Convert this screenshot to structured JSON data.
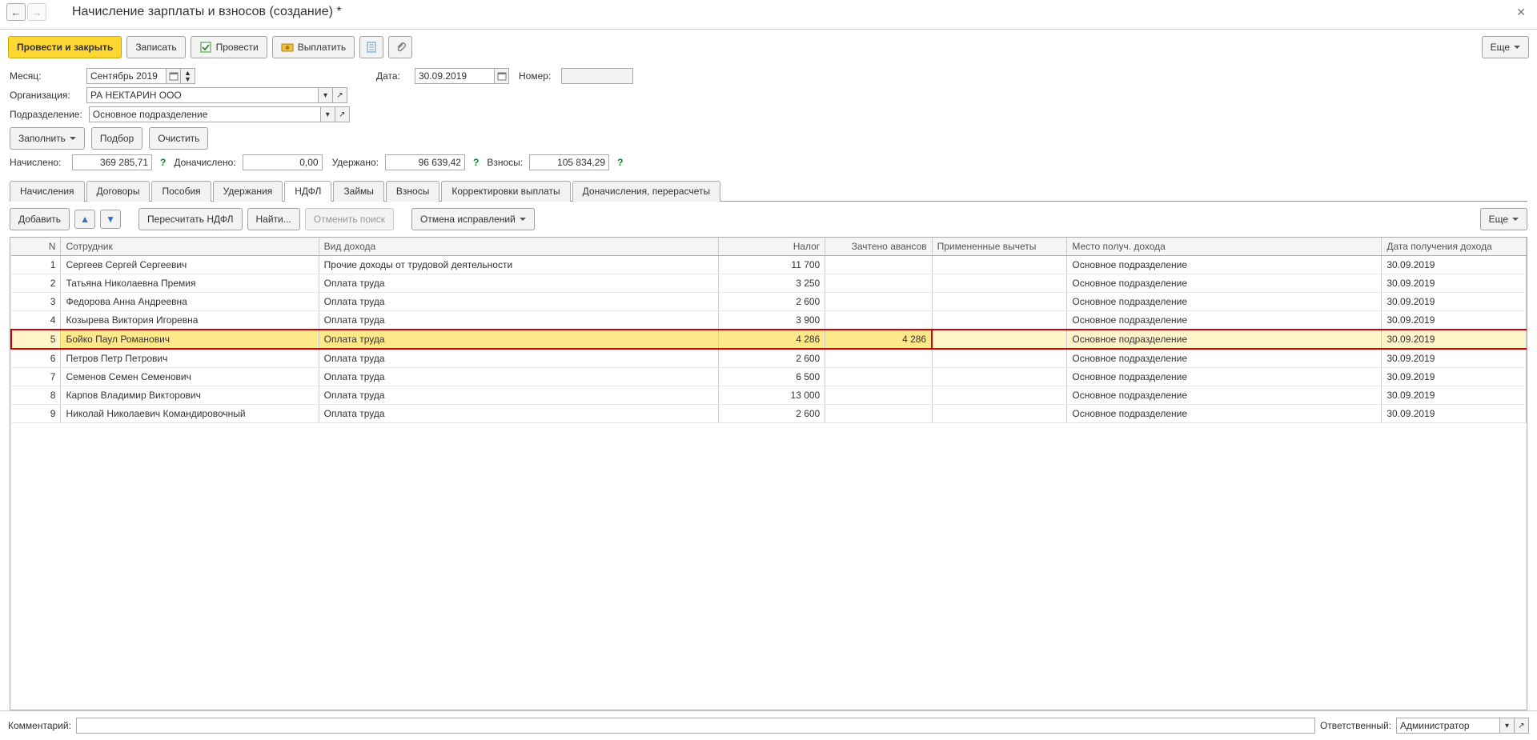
{
  "title": "Начисление зарплаты и взносов (создание) *",
  "toolbar": {
    "post_close": "Провести и закрыть",
    "save": "Записать",
    "post": "Провести",
    "pay": "Выплатить",
    "more": "Еще"
  },
  "form": {
    "month_lbl": "Месяц:",
    "month_val": "Сентябрь 2019",
    "date_lbl": "Дата:",
    "date_val": "30.09.2019",
    "number_lbl": "Номер:",
    "number_val": "",
    "org_lbl": "Организация:",
    "org_val": "РА НЕКТАРИН ООО",
    "dept_lbl": "Подразделение:",
    "dept_val": "Основное подразделение",
    "fill": "Заполнить",
    "pick": "Подбор",
    "clear": "Очистить",
    "accrued_lbl": "Начислено:",
    "accrued_val": "369 285,71",
    "extra_lbl": "Доначислено:",
    "extra_val": "0,00",
    "withheld_lbl": "Удержано:",
    "withheld_val": "96 639,42",
    "contrib_lbl": "Взносы:",
    "contrib_val": "105 834,29"
  },
  "tabs": [
    "Начисления",
    "Договоры",
    "Пособия",
    "Удержания",
    "НДФЛ",
    "Займы",
    "Взносы",
    "Корректировки выплаты",
    "Доначисления, перерасчеты"
  ],
  "active_tab": 4,
  "sub": {
    "add": "Добавить",
    "recalc": "Пересчитать НДФЛ",
    "find": "Найти...",
    "cancel_search": "Отменить поиск",
    "cancel_fix": "Отмена исправлений",
    "more": "Еще"
  },
  "cols": [
    "N",
    "Сотрудник",
    "Вид дохода",
    "Налог",
    "Зачтено авансов",
    "Примененные вычеты",
    "Место получ. дохода",
    "Дата получения дохода"
  ],
  "rows": [
    {
      "n": "1",
      "emp": "Сергеев Сергей Сергеевич",
      "type": "Прочие доходы от трудовой деятельности",
      "tax": "11 700",
      "adv": "",
      "ded": "",
      "loc": "Основное подразделение",
      "date": "30.09.2019"
    },
    {
      "n": "2",
      "emp": "Татьяна Николаевна Премия",
      "type": "Оплата труда",
      "tax": "3 250",
      "adv": "",
      "ded": "",
      "loc": "Основное подразделение",
      "date": "30.09.2019"
    },
    {
      "n": "3",
      "emp": "Федорова Анна Андреевна",
      "type": "Оплата труда",
      "tax": "2 600",
      "adv": "",
      "ded": "",
      "loc": "Основное подразделение",
      "date": "30.09.2019"
    },
    {
      "n": "4",
      "emp": "Козырева Виктория Игоревна",
      "type": "Оплата труда",
      "tax": "3 900",
      "adv": "",
      "ded": "",
      "loc": "Основное подразделение",
      "date": "30.09.2019"
    },
    {
      "n": "5",
      "emp": "Бойко Паул Романович",
      "type": "Оплата труда",
      "tax": "4 286",
      "adv": "4 286",
      "ded": "",
      "loc": "Основное подразделение",
      "date": "30.09.2019",
      "hl": true
    },
    {
      "n": "6",
      "emp": "Петров Петр Петрович",
      "type": "Оплата труда",
      "tax": "2 600",
      "adv": "",
      "ded": "",
      "loc": "Основное подразделение",
      "date": "30.09.2019"
    },
    {
      "n": "7",
      "emp": "Семенов Семен Семенович",
      "type": "Оплата труда",
      "tax": "6 500",
      "adv": "",
      "ded": "",
      "loc": "Основное подразделение",
      "date": "30.09.2019"
    },
    {
      "n": "8",
      "emp": "Карпов Владимир Викторович",
      "type": "Оплата труда",
      "tax": "13 000",
      "adv": "",
      "ded": "",
      "loc": "Основное подразделение",
      "date": "30.09.2019"
    },
    {
      "n": "9",
      "emp": "Николай Николаевич Командировочный",
      "type": "Оплата труда",
      "tax": "2 600",
      "adv": "",
      "ded": "",
      "loc": "Основное подразделение",
      "date": "30.09.2019"
    }
  ],
  "footer": {
    "comment_lbl": "Комментарий:",
    "comment_val": "",
    "resp_lbl": "Ответственный:",
    "resp_val": "Администратор"
  }
}
